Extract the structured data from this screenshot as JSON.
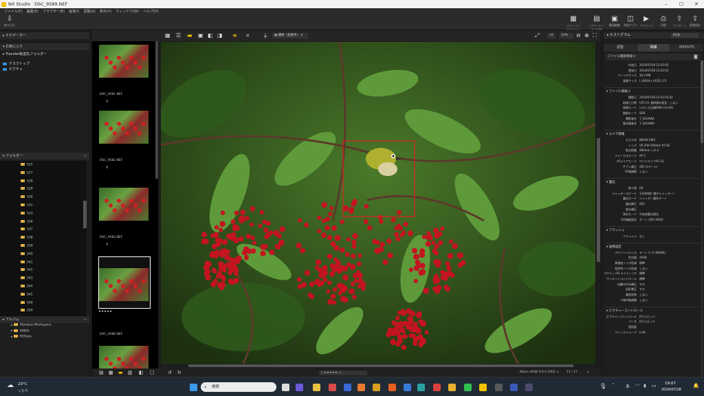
{
  "app": {
    "name": "NX Studio",
    "file": "DSC_9589.NEF"
  },
  "menu": [
    "ファイル(F)",
    "編集(E)",
    "ブラウザー(B)",
    "画像(I)",
    "調整(A)",
    "表示(V)",
    "ウィンドウ(W)",
    "ヘルプ(H)"
  ],
  "toolbar": {
    "import_label": "取り込む",
    "right_buttons": [
      "ピクチャーコントロールユーティリティ",
      "ピクチャーコントロールの作成",
      "動画編集",
      "合成アプリ",
      "スライドショー",
      "印刷",
      "アップロード",
      "変換保存"
    ]
  },
  "left": {
    "navigator": "ナビゲーター",
    "favorites": "お気に入り",
    "fav_items": [
      "Transfer転送先フォルダー",
      "デスクトップ",
      "ピクチャ"
    ],
    "folders": "フォルダー",
    "folder_items": [
      "525",
      "527",
      "528",
      "529",
      "530",
      "531",
      "533",
      "534",
      "537",
      "538",
      "539",
      "540",
      "541",
      "542",
      "543",
      "544",
      "545",
      "549",
      "550",
      "Olympus Workspace",
      "OMDS",
      "PGTools"
    ],
    "album": "アルバム"
  },
  "filmstrip": {
    "names": [
      "DSC_9581.NEF",
      "DSC_9582.NEF",
      "DSC_9583.NEF",
      "DSC_9589.NEF"
    ],
    "rating": "★★★★★"
  },
  "viewer": {
    "sort_label": "撮像（変換手）",
    "zoom": "33%",
    "position": "11 / 27",
    "color_info": "Nikon sRGB 4.0.0.3002"
  },
  "right": {
    "histogram": "ヒストグラム",
    "hist_mode": "RGB",
    "tabs": [
      "調整",
      "情報",
      "XMP/IPTC"
    ],
    "file_section": "ファイル撮影情報",
    "file_rows": [
      [
        "作成日",
        "2024/07/28 12:43:03"
      ],
      [
        "更新日",
        "2024/07/28 12:43:03"
      ],
      [
        "ファイルサイズ",
        "30.4 MB"
      ],
      [
        "画像サイズ",
        "L (6048 x 4032), FX"
      ]
    ],
    "file2_section": "ファイル情報 2",
    "file2_rows": [
      [
        "撮影日",
        "2024/07/28 12:43:03.02"
      ],
      [
        "地域と日時",
        "UTC+9, 夏時間の設定 : しない"
      ],
      [
        "画質モード",
        "ロスレス圧縮RAW (14-bit)"
      ],
      [
        "階調モード",
        "SDR"
      ],
      [
        "撮影者名",
        "T_SAGAWA"
      ],
      [
        "著作権者名",
        "T_SAGAWA"
      ]
    ],
    "camera_section": "カメラ情報",
    "camera_rows": [
      [
        "モデル名",
        "NIKON Z6III"
      ],
      [
        "レンズ",
        "VR 200-500mm f/5.6E"
      ],
      [
        "焦点距離",
        "680mm / x1.4"
      ],
      [
        "フォーカスモード",
        "AF-C"
      ],
      [
        "AFエリアモード",
        "ワイドエリアAF (S)"
      ],
      [
        "手ブレ補正",
        "ON (スポーツ)"
      ],
      [
        "AF微調節",
        "しない"
      ]
    ],
    "exposure_section": "露出",
    "exposure_rows": [
      [
        "絞り値",
        "f/8"
      ],
      [
        "シャッタースピード",
        "1/2000秒 (電子シャッター)"
      ],
      [
        "露出モード",
        "シャッター優先オート"
      ],
      [
        "露出補正",
        "0EV"
      ],
      [
        "調光補正",
        ""
      ],
      [
        "測光モード",
        "中央部重点測光"
      ],
      [
        "ISO感度設定",
        "オート (ISO 3600)"
      ]
    ],
    "flash_section": "フラッシュ",
    "flash_rows": [
      [
        "フラッシュ",
        "なし"
      ]
    ],
    "image_section": "画像設定",
    "image_rows": [
      [
        "ホワイトバランス",
        "オート 0, 0 (4800K)"
      ],
      [
        "色空間",
        "sRGB"
      ],
      [
        "高感度ノイズ低減",
        "標準"
      ],
      [
        "長秒時ノイズ低減",
        "しない"
      ],
      [
        "アクティブD-ライティング",
        "標準"
      ],
      [
        "ヴィネットコントロール",
        "標準"
      ],
      [
        "自動ゆがみ補正",
        "する"
      ],
      [
        "回折補正",
        "する"
      ],
      [
        "美肌効果",
        "しない"
      ],
      [
        "人物印象調整",
        "しない"
      ]
    ],
    "pc_section": "ピクチャーコントロール",
    "pc_rows": [
      [
        "ピクチャーコントロール",
        "[V] ビビッド"
      ],
      [
        "ベース",
        "[V] ビビッド"
      ],
      [
        "適用度",
        ""
      ],
      [
        "クイックシャープ",
        "0.00"
      ]
    ]
  },
  "taskbar": {
    "temp": "23°C",
    "weather": "くもり",
    "search": "検索",
    "time": "19:07",
    "date": "2024/07/28"
  }
}
